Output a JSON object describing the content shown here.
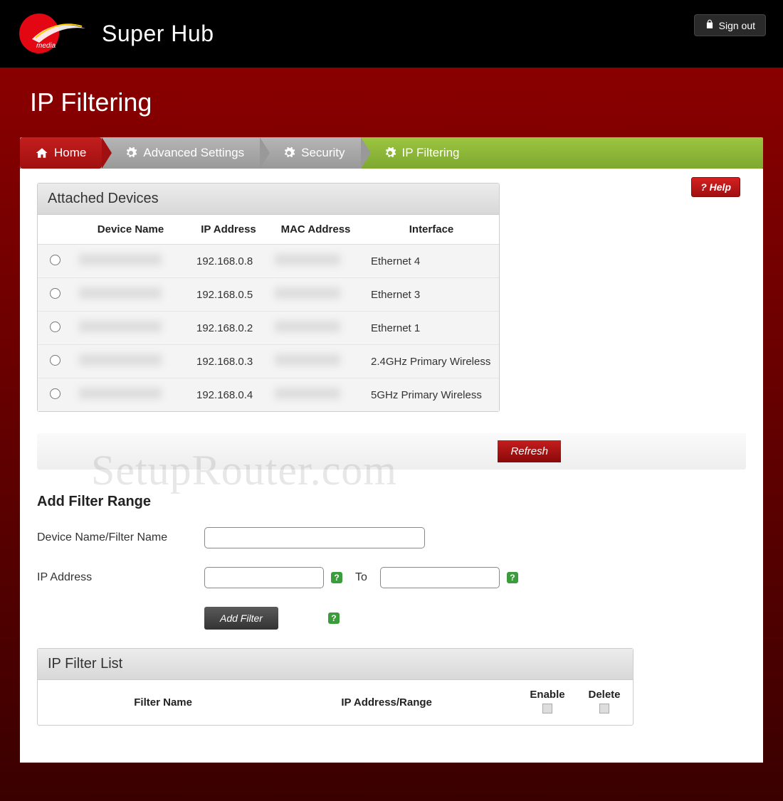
{
  "header": {
    "app_title": "Super Hub",
    "logo_text": "media",
    "signout_label": "Sign out"
  },
  "page_title": "IP Filtering",
  "breadcrumb": {
    "home": "Home",
    "advanced": "Advanced Settings",
    "security": "Security",
    "current": "IP Filtering"
  },
  "help_label": "? Help",
  "attached_devices": {
    "title": "Attached Devices",
    "columns": {
      "device_name": "Device Name",
      "ip_address": "IP Address",
      "mac_address": "MAC Address",
      "interface": "Interface"
    },
    "rows": [
      {
        "ip": "192.168.0.8",
        "interface": "Ethernet 4"
      },
      {
        "ip": "192.168.0.5",
        "interface": "Ethernet 3"
      },
      {
        "ip": "192.168.0.2",
        "interface": "Ethernet 1"
      },
      {
        "ip": "192.168.0.3",
        "interface": "2.4GHz Primary Wireless"
      },
      {
        "ip": "192.168.0.4",
        "interface": "5GHz Primary Wireless"
      }
    ]
  },
  "refresh_label": "Refresh",
  "add_filter": {
    "title": "Add Filter Range",
    "device_name_label": "Device Name/Filter Name",
    "ip_label": "IP Address",
    "to_label": "To",
    "button_label": "Add Filter",
    "hint_char": "?"
  },
  "filter_list": {
    "title": "IP Filter List",
    "columns": {
      "filter_name": "Filter Name",
      "ip_range": "IP Address/Range",
      "enable": "Enable",
      "delete": "Delete"
    }
  },
  "watermark": "SetupRouter.com"
}
